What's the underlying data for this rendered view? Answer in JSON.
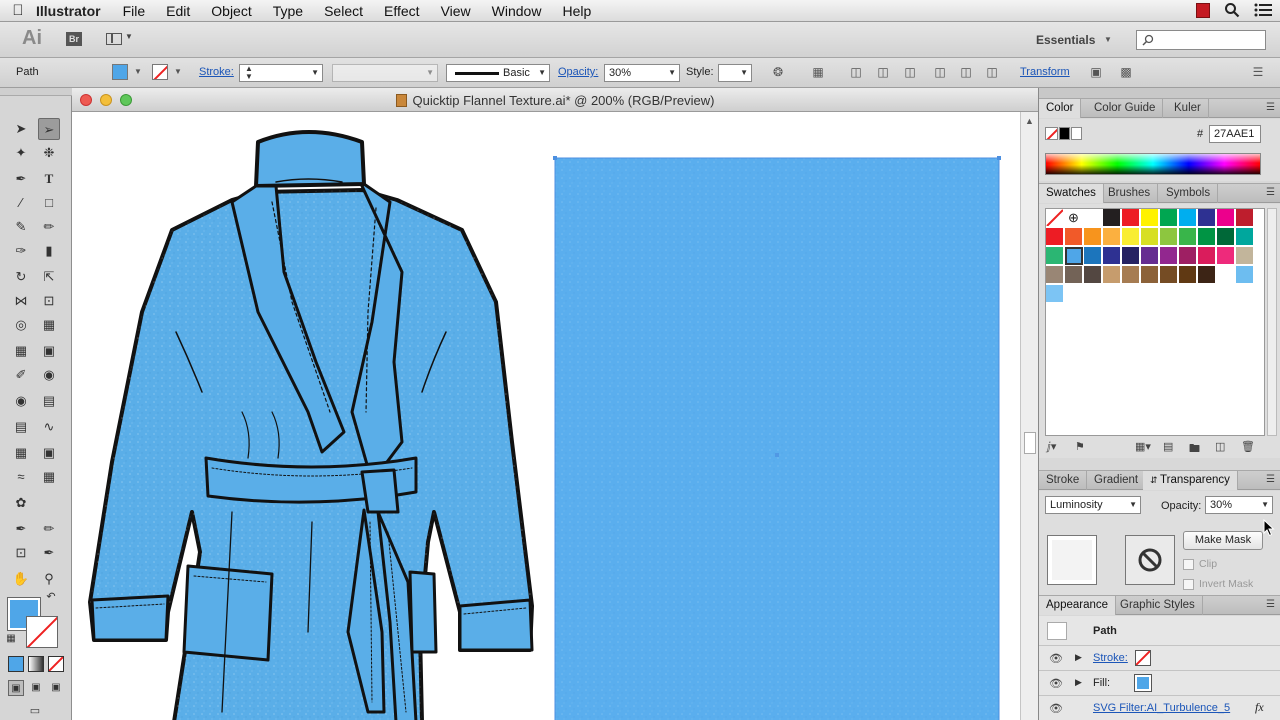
{
  "menubar": {
    "app_name": "Illustrator",
    "items": [
      "File",
      "Edit",
      "Object",
      "Type",
      "Select",
      "Effect",
      "View",
      "Window",
      "Help"
    ]
  },
  "appbar": {
    "logo": "Ai",
    "bridge": "Br",
    "workspace": "Essentials"
  },
  "control": {
    "selection_label": "Path",
    "stroke_label": "Stroke:",
    "brush_label": "Basic",
    "opacity_label": "Opacity:",
    "opacity_value": "30%",
    "style_label": "Style:",
    "transform_label": "Transform"
  },
  "document": {
    "title": "Quicktip Flannel Texture.ai* @ 200% (RGB/Preview)",
    "fill_color": "#4fa6e8"
  },
  "color_panel": {
    "tabs": [
      "Color",
      "Color Guide",
      "Kuler"
    ],
    "hex_label": "#",
    "hex_value": "27AAE1"
  },
  "swatches_panel": {
    "tabs": [
      "Swatches",
      "Brushes",
      "Symbols"
    ]
  },
  "transparency_panel": {
    "tabs": [
      "Stroke",
      "Gradient",
      "Transparency"
    ],
    "blend_mode": "Luminosity",
    "opacity_label": "Opacity:",
    "opacity_value": "30%",
    "make_mask": "Make Mask",
    "clip": "Clip",
    "invert_mask": "Invert Mask"
  },
  "appearance_panel": {
    "tabs": [
      "Appearance",
      "Graphic Styles"
    ],
    "object": "Path",
    "stroke_label": "Stroke:",
    "fill_label": "Fill:",
    "effect_label": "SVG Filter:AI_Turbulence_5",
    "fx": "fx"
  }
}
